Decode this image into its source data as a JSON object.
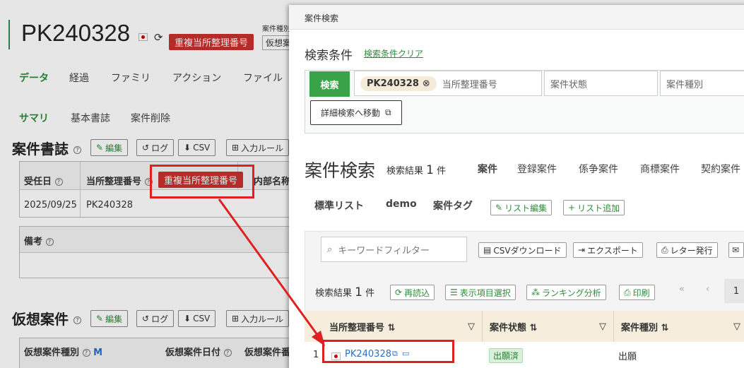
{
  "background_page": {
    "title": "PK240328",
    "badge": "重複当所整理番号",
    "side_label_1": "案件種別",
    "side_label_2": "仮想案",
    "nav": [
      "データ",
      "経過",
      "ファミリ",
      "アクション",
      "ファイル"
    ],
    "subnav": [
      "サマリ",
      "基本書誌",
      "案件削除"
    ],
    "section1": {
      "title": "案件書誌",
      "buttons": [
        "編集",
        "ログ",
        "CSV",
        "入力ルール"
      ]
    },
    "table1": {
      "headers": [
        "受任日",
        "当所整理番号",
        "重複当所整理番号",
        "内部名称"
      ],
      "row": [
        "2025/09/25",
        "PK240328"
      ],
      "remarks": "備考"
    },
    "section2": {
      "title": "仮想案件",
      "buttons": [
        "編集",
        "ログ",
        "CSV",
        "入力ルール"
      ]
    },
    "table2": {
      "headers": [
        "仮想案件種別",
        "M",
        "仮想案件日付",
        "仮想案件番"
      ]
    }
  },
  "modal": {
    "header": "案件検索",
    "conditions_label": "検索条件",
    "clear_link": "検索条件クリア",
    "search_button": "検索",
    "chip_value": "PK240328",
    "field_ref": "当所整理番号",
    "field_status": "案件状態",
    "field_type": "案件種別",
    "advanced_button": "詳細検索へ移動",
    "results_title": "案件検索",
    "results_count_label": "検索結果",
    "results_count": "1",
    "results_unit": "件",
    "category_tabs": [
      "案件",
      "登録案件",
      "係争案件",
      "商標案件",
      "契約案件"
    ],
    "list_tabs": [
      "標準リスト",
      "demo",
      "案件タグ"
    ],
    "list_edit": "リスト編集",
    "list_add": "リスト追加",
    "filter_placeholder": "キーワードフィルター",
    "toolbar": [
      "CSVダウンロード",
      "エクスポート",
      "レター発行"
    ],
    "result_bar": {
      "label": "検索結果",
      "count": "1",
      "unit": "件",
      "buttons": [
        "再読込",
        "表示項目選択",
        "ランキング分析",
        "印刷"
      ],
      "page": "1"
    },
    "columns": [
      "当所整理番号",
      "案件状態",
      "案件種別"
    ],
    "row": {
      "index": "1",
      "ref": "PK240328",
      "status": "出願済",
      "type": "出願"
    }
  }
}
